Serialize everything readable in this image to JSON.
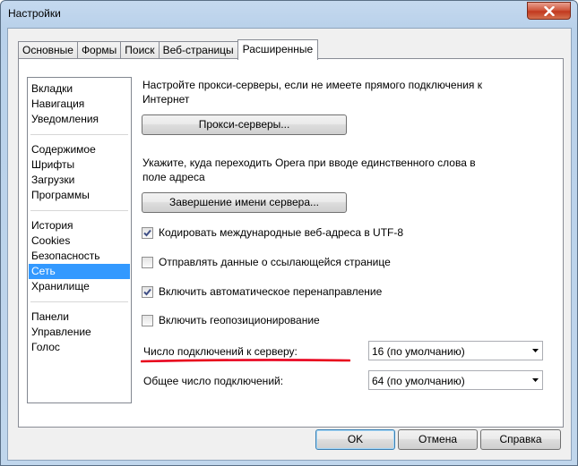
{
  "window": {
    "title": "Настройки"
  },
  "tabs": [
    {
      "label": "Основные",
      "active": false
    },
    {
      "label": "Формы",
      "active": false
    },
    {
      "label": "Поиск",
      "active": false
    },
    {
      "label": "Веб-страницы",
      "active": false
    },
    {
      "label": "Расширенные",
      "active": true
    }
  ],
  "sidebar": {
    "groups": [
      [
        "Вкладки",
        "Навигация",
        "Уведомления"
      ],
      [
        "Содержимое",
        "Шрифты",
        "Загрузки",
        "Программы"
      ],
      [
        "История",
        "Cookies",
        "Безопасность",
        "Сеть",
        "Хранилище"
      ],
      [
        "Панели",
        "Управление",
        "Голос"
      ]
    ],
    "selected": "Сеть"
  },
  "network": {
    "proxy_desc_line1": "Настройте прокси-серверы, если не имеете прямого подключения к",
    "proxy_desc_line2": "Интернет",
    "proxy_button": "Прокси-серверы...",
    "server_desc_line1": "Укажите, куда переходить Opera при вводе единственного слова в",
    "server_desc_line2": "поле адреса",
    "server_button": "Завершение имени сервера...",
    "checkboxes": [
      {
        "label": "Кодировать международные веб-адреса в UTF-8",
        "checked": true
      },
      {
        "label": "Отправлять данные о ссылающейся странице",
        "checked": false
      },
      {
        "label": "Включить автоматическое перенаправление",
        "checked": true
      },
      {
        "label": "Включить геопозиционирование",
        "checked": false
      }
    ],
    "per_server_label": "Число подключений к серверу:",
    "per_server_value": "16 (по умолчанию)",
    "total_label": "Общее число подключений:",
    "total_value": "64 (по умолчанию)"
  },
  "footer": {
    "ok": "OK",
    "cancel": "Отмена",
    "help": "Справка"
  },
  "colors": {
    "selection": "#3399ff",
    "annotation": "#e8001c",
    "checkmark": "#3f4f86"
  }
}
